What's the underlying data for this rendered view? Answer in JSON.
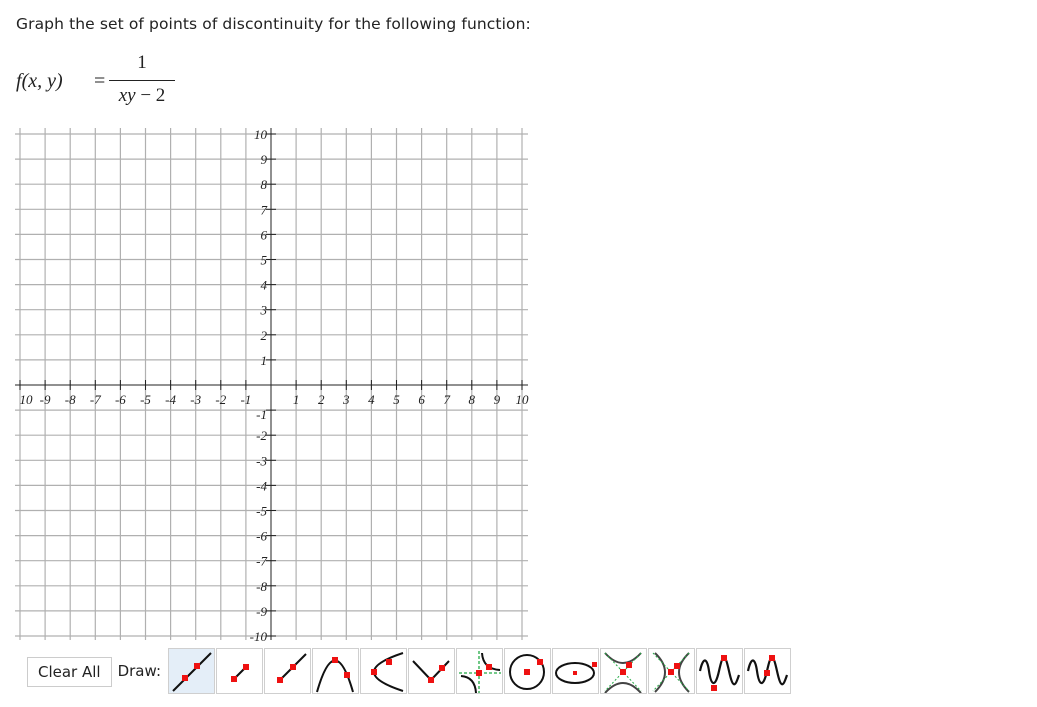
{
  "prompt": "Graph the set of points of discontinuity for the following function:",
  "formula": {
    "lhs_f": "f",
    "lhs_args": "(x, y)",
    "equals": "=",
    "numerator": "1",
    "denominator_vars": "xy",
    "denominator_rest": " − 2"
  },
  "graph": {
    "x_range": [
      -10,
      10
    ],
    "y_range": [
      -10,
      10
    ],
    "grid_step": 1,
    "x_tick_labels": [
      "10",
      "-9",
      "-8",
      "-7",
      "-6",
      "-5",
      "-4",
      "-3",
      "-2",
      "-1",
      "1",
      "2",
      "3",
      "4",
      "5",
      "6",
      "7",
      "8",
      "9",
      "10"
    ],
    "y_tick_labels": [
      "10",
      "9",
      "8",
      "7",
      "6",
      "5",
      "4",
      "3",
      "2",
      "1",
      "-1",
      "-2",
      "-3",
      "-4",
      "-5",
      "-6",
      "-7",
      "-8",
      "-9",
      "-10"
    ],
    "colors": {
      "grid": "#b0b0b0",
      "axis": "#222222"
    }
  },
  "toolbar": {
    "clear_label": "Clear All",
    "draw_label": "Draw:",
    "tools": [
      {
        "name": "line",
        "icon": "line-icon",
        "active": true
      },
      {
        "name": "segment",
        "icon": "segment-icon",
        "active": false
      },
      {
        "name": "ray",
        "icon": "ray-icon",
        "active": false
      },
      {
        "name": "parabola-vertical",
        "icon": "parabola-vertical-icon",
        "active": false
      },
      {
        "name": "parabola-horizontal",
        "icon": "parabola-horizontal-icon",
        "active": false
      },
      {
        "name": "absolute-value",
        "icon": "absolute-value-icon",
        "active": false
      },
      {
        "name": "rational",
        "icon": "rational-icon",
        "active": false
      },
      {
        "name": "circle",
        "icon": "circle-icon",
        "active": false
      },
      {
        "name": "ellipse",
        "icon": "ellipse-icon",
        "active": false
      },
      {
        "name": "hyperbola-vertical",
        "icon": "hyperbola-vertical-icon",
        "active": false
      },
      {
        "name": "hyperbola-horizontal",
        "icon": "hyperbola-horizontal-icon",
        "active": false
      },
      {
        "name": "sine",
        "icon": "sine-icon",
        "active": false
      },
      {
        "name": "cosine",
        "icon": "cosine-icon",
        "active": false
      }
    ],
    "colors": {
      "point": "#ee1111",
      "curve": "#111111",
      "asymptote": "#22aa44",
      "active_bg": "#e4eef8"
    }
  }
}
